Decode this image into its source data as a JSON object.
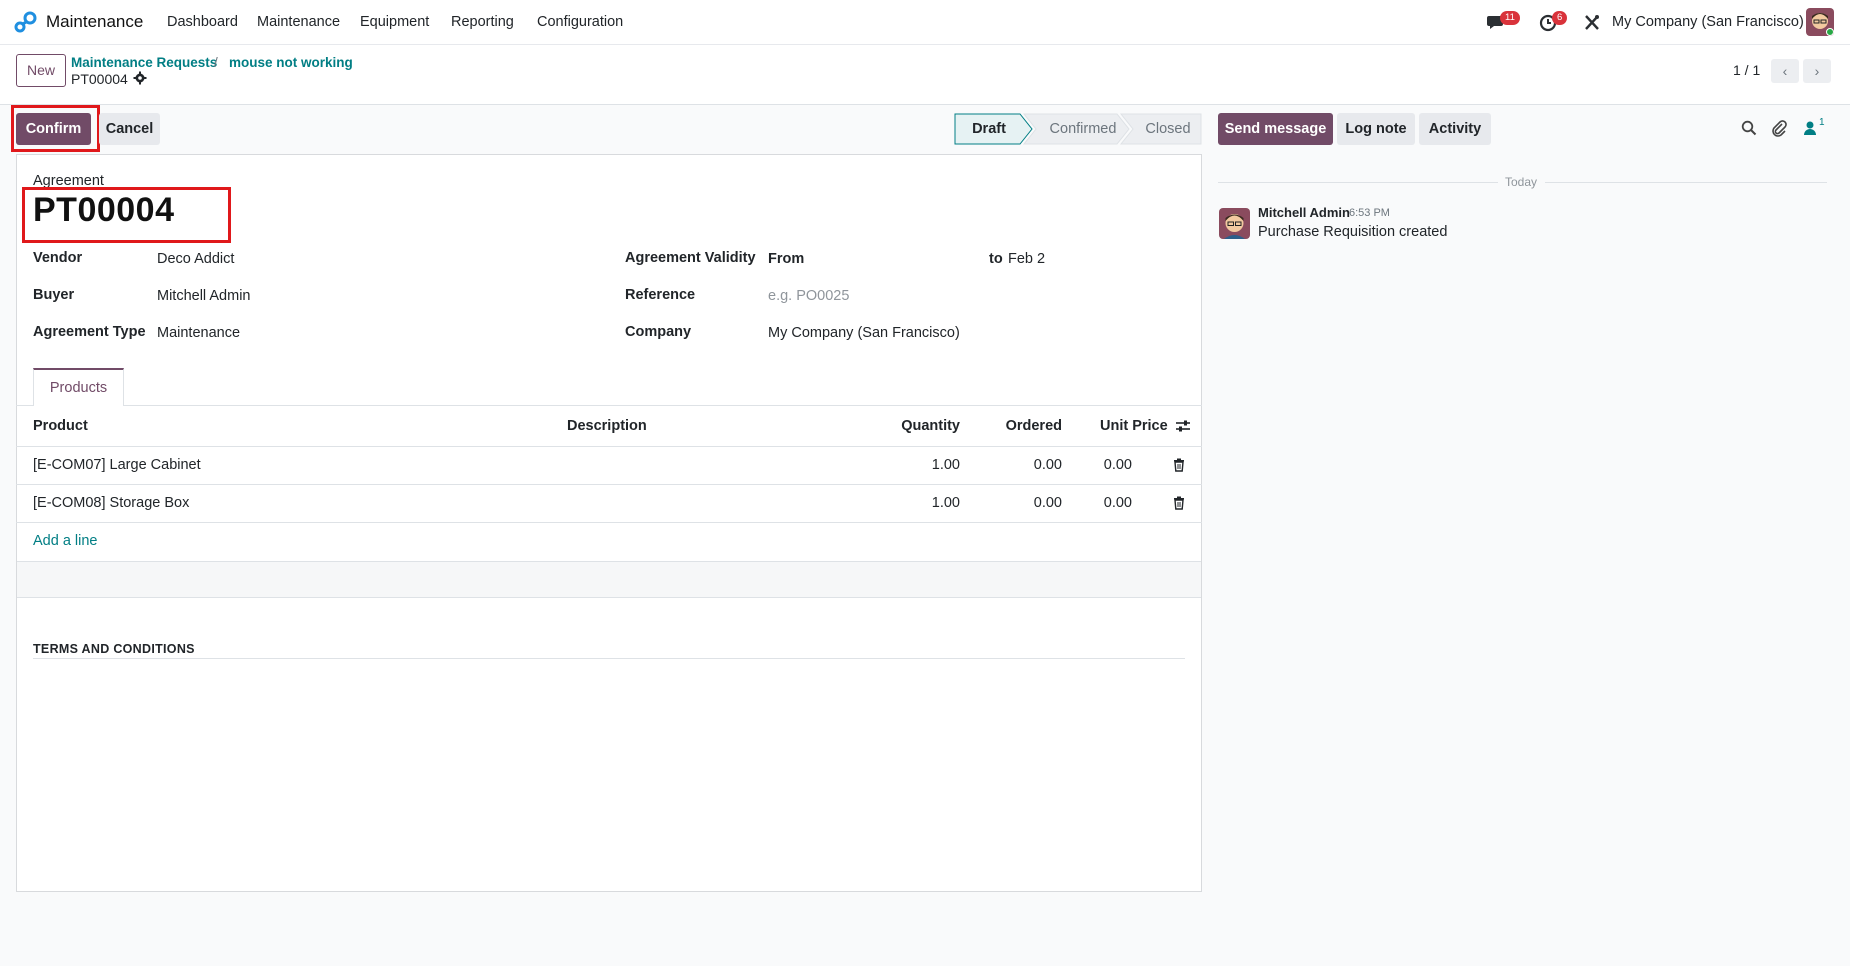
{
  "nav": {
    "app_name": "Maintenance",
    "menu": [
      "Dashboard",
      "Maintenance",
      "Equipment",
      "Reporting",
      "Configuration"
    ],
    "messages_count": "11",
    "activities_count": "6",
    "company": "My Company (San Francisco)"
  },
  "control_panel": {
    "new_label": "New",
    "breadcrumb": [
      "Maintenance Requests",
      "mouse not working"
    ],
    "breadcrumb_sep": "/",
    "current_record": "PT00004",
    "pager": "1 / 1"
  },
  "statusbar": {
    "confirm_label": "Confirm",
    "cancel_label": "Cancel",
    "stages": [
      "Draft",
      "Confirmed",
      "Closed"
    ],
    "active_stage": "Draft"
  },
  "chatter": {
    "send_message_label": "Send message",
    "log_note_label": "Log note",
    "activity_label": "Activity",
    "followers_count": "1",
    "date_separator": "Today",
    "messages": [
      {
        "author": "Mitchell Admin",
        "time": "6:53 PM",
        "body": "Purchase Requisition created"
      }
    ]
  },
  "form": {
    "name_label": "Agreement",
    "name_value": "PT00004",
    "vendor_label": "Vendor",
    "vendor_value": "Deco Addict",
    "buyer_label": "Buyer",
    "buyer_value": "Mitchell Admin",
    "type_label": "Agreement Type",
    "type_value": "Maintenance",
    "validity_label": "Agreement Validity",
    "from_label": "From",
    "to_label": "to",
    "to_value": "Feb 2",
    "reference_label": "Reference",
    "reference_placeholder": "e.g. PO0025",
    "company_label": "Company",
    "company_value": "My Company (San Francisco)",
    "tab_products": "Products",
    "terms_label": "TERMS AND CONDITIONS"
  },
  "lines": {
    "headers": {
      "product": "Product",
      "description": "Description",
      "quantity": "Quantity",
      "ordered": "Ordered",
      "unit_price": "Unit Price"
    },
    "rows": [
      {
        "product": "[E-COM07] Large Cabinet",
        "description": "",
        "quantity": "1.00",
        "ordered": "0.00",
        "unit_price": "0.00"
      },
      {
        "product": "[E-COM08] Storage Box",
        "description": "",
        "quantity": "1.00",
        "ordered": "0.00",
        "unit_price": "0.00"
      }
    ],
    "add_line": "Add a line"
  },
  "colors": {
    "primary": "#714b67",
    "link": "#017e84",
    "badge": "#d9333b",
    "highlight": "#e0181b"
  }
}
